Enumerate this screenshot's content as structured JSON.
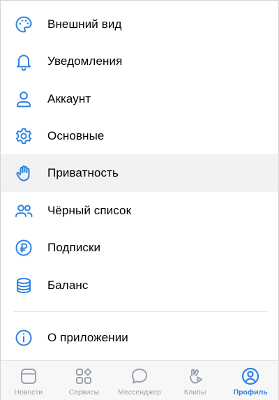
{
  "colors": {
    "accent": "#2d81e0",
    "inactive_tab": "#99a2ad",
    "active_row_bg": "#f2f2f2"
  },
  "menu": {
    "items": [
      {
        "label": "Внешний вид",
        "icon": "palette-icon"
      },
      {
        "label": "Уведомления",
        "icon": "bell-icon"
      },
      {
        "label": "Аккаунт",
        "icon": "user-icon"
      },
      {
        "label": "Основные",
        "icon": "gear-icon"
      },
      {
        "label": "Приватность",
        "icon": "hand-icon"
      },
      {
        "label": "Чёрный список",
        "icon": "users-icon"
      },
      {
        "label": "Подписки",
        "icon": "ruble-icon"
      },
      {
        "label": "Баланс",
        "icon": "coins-stack-icon"
      },
      {
        "label": "О приложении",
        "icon": "info-icon"
      }
    ]
  },
  "tabbar": {
    "tabs": [
      {
        "label": "Новости",
        "icon": "newsfeed-icon"
      },
      {
        "label": "Сервисы",
        "icon": "services-icon"
      },
      {
        "label": "Мессенджер",
        "icon": "message-icon"
      },
      {
        "label": "Клипы",
        "icon": "clips-icon"
      },
      {
        "label": "Профиль",
        "icon": "profile-icon",
        "selected": true
      }
    ]
  }
}
